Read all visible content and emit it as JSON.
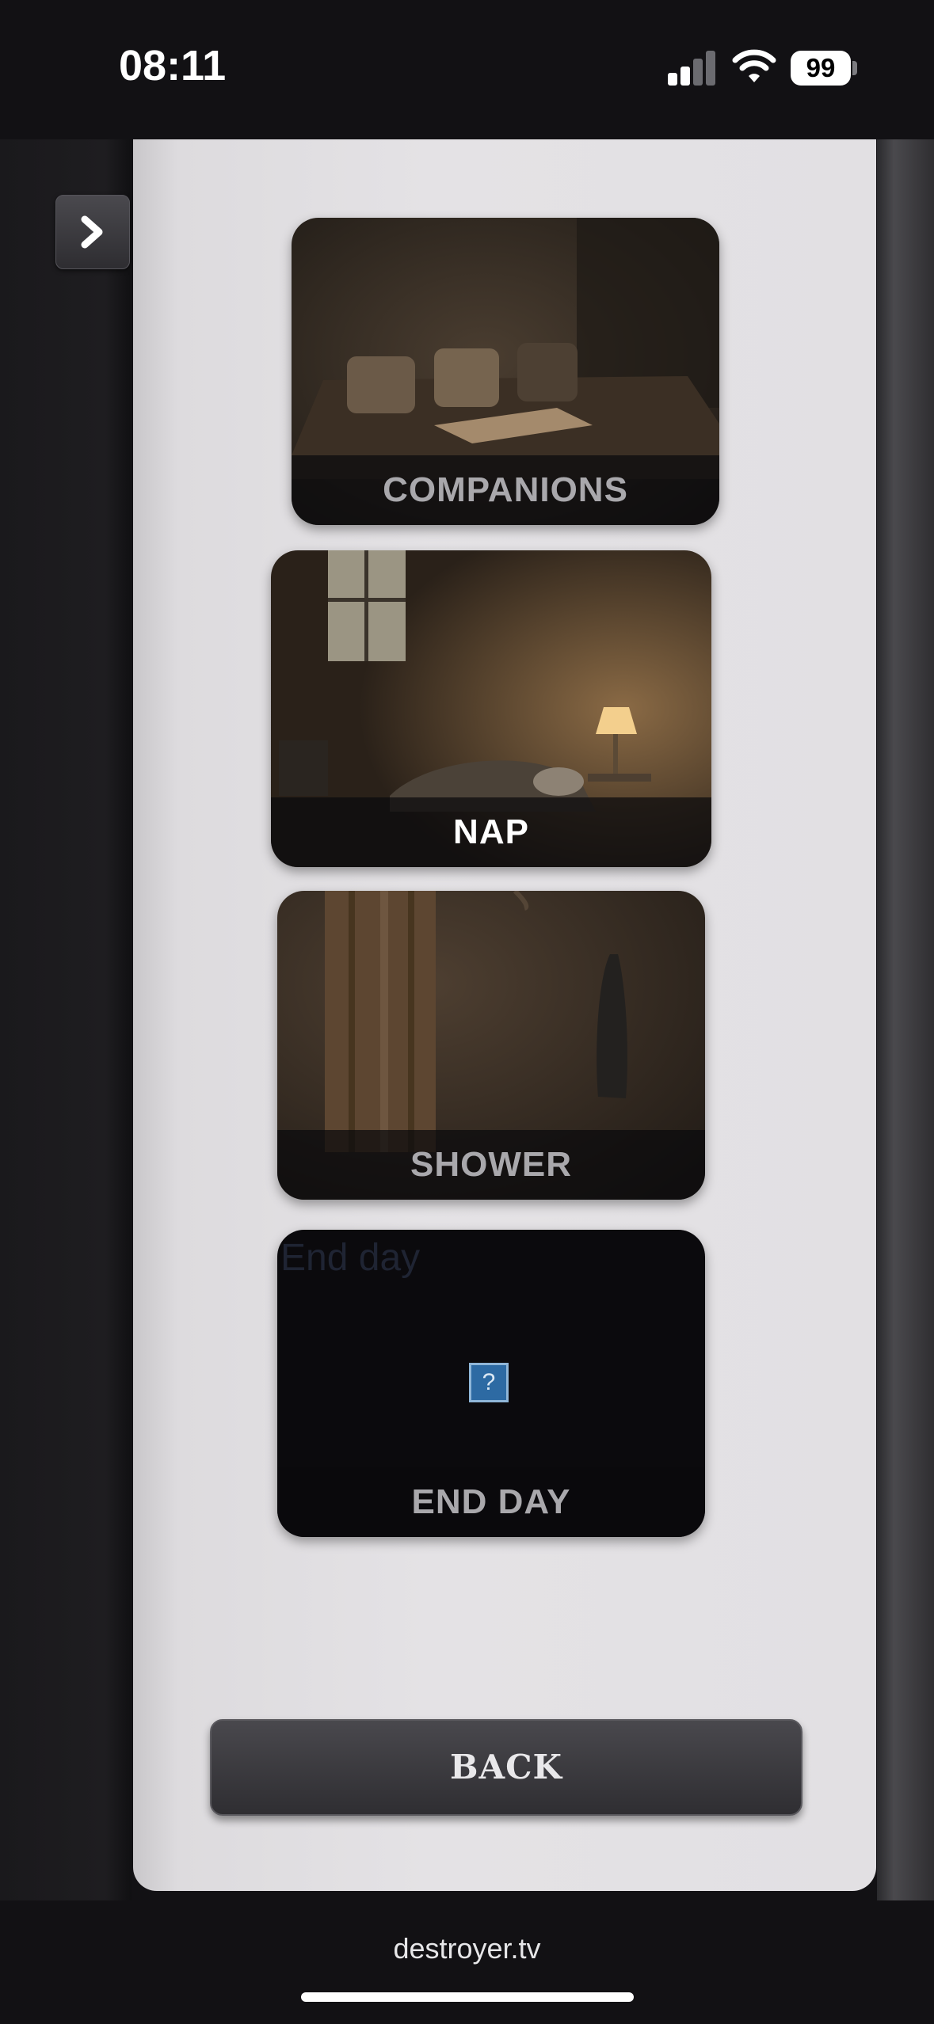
{
  "status_bar": {
    "time": "08:11",
    "battery": "99"
  },
  "cards": [
    {
      "label": "COMPANIONS"
    },
    {
      "label": "NAP"
    },
    {
      "label": "SHOWER"
    },
    {
      "label": "END DAY",
      "alt_text": "End day",
      "broken_image_glyph": "?"
    }
  ],
  "back_button": {
    "label": "BACK"
  },
  "browser": {
    "url": "destroyer.tv"
  },
  "colors": {
    "panel_bg": "#e2e0e3",
    "dark_bg": "#121114",
    "card_label": "#a9a8ac"
  }
}
